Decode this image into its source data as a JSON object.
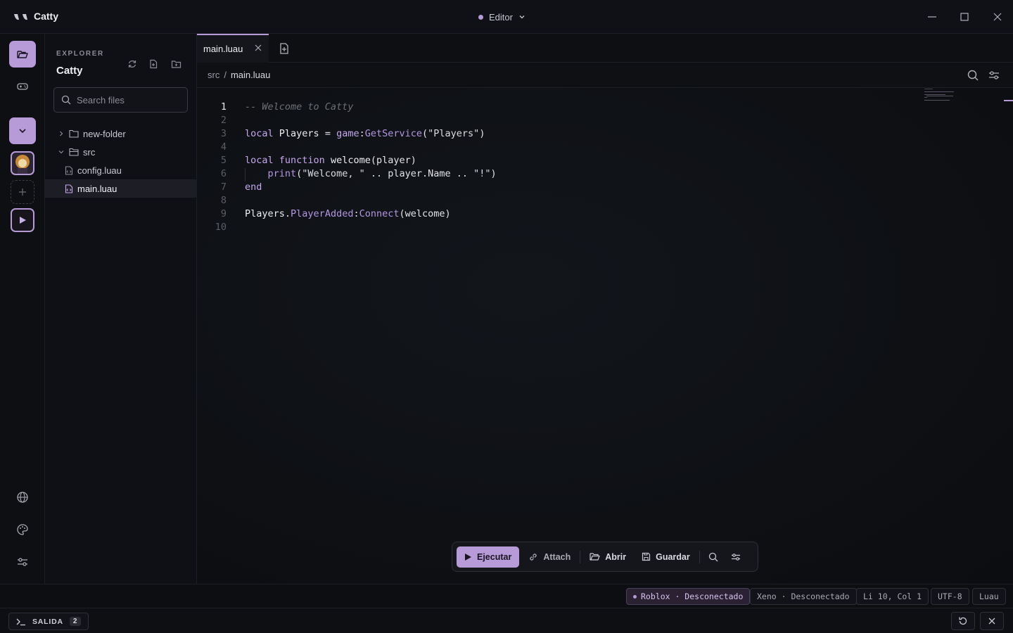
{
  "app": {
    "title": "Catty",
    "mode": "Editor"
  },
  "activity": {
    "items": [
      "explorer-icon",
      "gamepad-icon",
      "chevron-down-icon",
      "avatar",
      "plus-icon",
      "play-icon",
      "globe-icon",
      "palette-icon",
      "sliders-icon"
    ]
  },
  "explorer": {
    "heading": "EXPLORER",
    "project": "Catty",
    "search_placeholder": "Search files",
    "tree": [
      {
        "name": "new-folder",
        "type": "folder",
        "expanded": false
      },
      {
        "name": "src",
        "type": "folder",
        "expanded": true
      },
      {
        "name": "config.luau",
        "type": "file"
      },
      {
        "name": "main.luau",
        "type": "file",
        "active": true
      }
    ]
  },
  "tabs": [
    {
      "label": "main.luau",
      "active": true
    }
  ],
  "breadcrumb": {
    "folder": "src",
    "separator": "/",
    "file": "main.luau"
  },
  "editor": {
    "current_line": 1,
    "lines": [
      "-- Welcome to Catty",
      "",
      "local Players = game:GetService(\"Players\")",
      "",
      "local function welcome(player)",
      "    print(\"Welcome, \" .. player.Name .. \"!\")",
      "end",
      "",
      "Players.PlayerAdded:Connect(welcome)",
      ""
    ]
  },
  "toolbar": {
    "run": "Ejecutar",
    "attach": "Attach",
    "open": "Abrir",
    "save": "Guardar"
  },
  "status": {
    "roblox": "Roblox · Desconectado",
    "xeno": "Xeno · Desconectado",
    "position": "Li 10, Col 1",
    "encoding": "UTF-8",
    "language": "Luau"
  },
  "output": {
    "label": "SALIDA",
    "count": "2"
  },
  "colors": {
    "accent": "#b79ad8",
    "background": "#0d0e12"
  }
}
